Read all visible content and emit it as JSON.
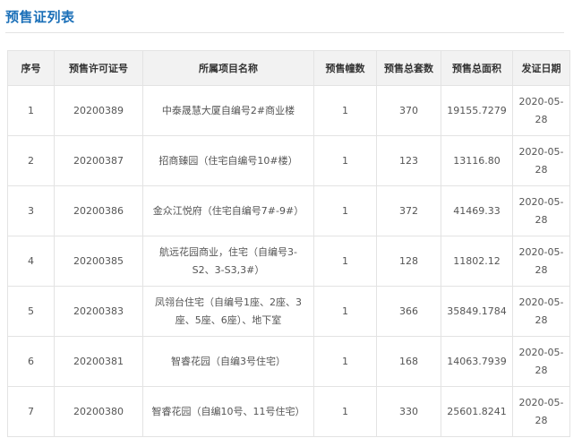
{
  "page": {
    "title": "预售证列表"
  },
  "table": {
    "headers": [
      "序号",
      "预售许可证号",
      "所属项目名称",
      "预售幢数",
      "预售总套数",
      "预售总面积",
      "发证日期"
    ],
    "rows": [
      {
        "index": "1",
        "permit_no": "20200389",
        "project": "中泰晟慧大厦自编号2#商业楼",
        "buildings": "1",
        "units": "370",
        "area": "19155.7279",
        "date": "2020-05-28"
      },
      {
        "index": "2",
        "permit_no": "20200387",
        "project": "招商臻园（住宅自编号10#楼）",
        "buildings": "1",
        "units": "123",
        "area": "13116.80",
        "date": "2020-05-28"
      },
      {
        "index": "3",
        "permit_no": "20200386",
        "project": "金众江悦府（住宅自编号7#-9#）",
        "buildings": "1",
        "units": "372",
        "area": "41469.33",
        "date": "2020-05-28"
      },
      {
        "index": "4",
        "permit_no": "20200385",
        "project": "航远花园商业，住宅（自编号3-S2、3-S3,3#）",
        "buildings": "1",
        "units": "128",
        "area": "11802.12",
        "date": "2020-05-28"
      },
      {
        "index": "5",
        "permit_no": "20200383",
        "project": "凤翎台住宅（自编号1座、2座、3座、5座、6座）、地下室",
        "buildings": "1",
        "units": "366",
        "area": "35849.1784",
        "date": "2020-05-28"
      },
      {
        "index": "6",
        "permit_no": "20200381",
        "project": "智睿花园（自编3号住宅）",
        "buildings": "1",
        "units": "168",
        "area": "14063.7939",
        "date": "2020-05-28"
      },
      {
        "index": "7",
        "permit_no": "20200380",
        "project": "智睿花园（自编10号、11号住宅）",
        "buildings": "1",
        "units": "330",
        "area": "25601.8241",
        "date": "2020-05-28"
      }
    ]
  }
}
